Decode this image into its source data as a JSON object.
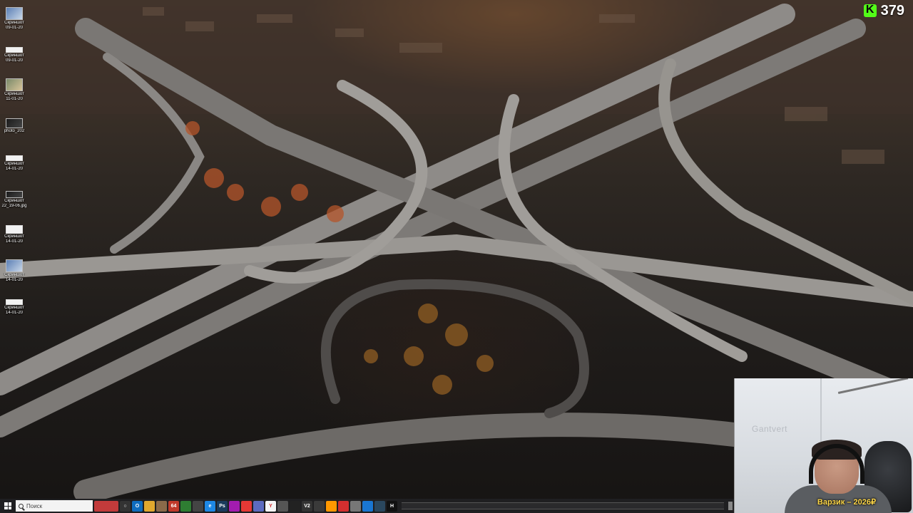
{
  "desktop_icons": [
    {
      "label1": "Скриншот",
      "label2": "09-01-20",
      "thumb": "screenshot"
    },
    {
      "label1": "Скриншот",
      "label2": "09-01-20",
      "thumb": "doc"
    },
    {
      "label1": "Скриншот",
      "label2": "11-01-20",
      "thumb": "photo"
    },
    {
      "label1": "photo_202",
      "label2": "",
      "thumb": "dark"
    },
    {
      "label1": "Скриншот",
      "label2": "14-01-20",
      "thumb": "doc"
    },
    {
      "label1": "Скриншот",
      "label2": "22_19-06.jpg",
      "thumb": "dark"
    },
    {
      "label1": "Скриншот",
      "label2": "14-01-20",
      "thumb": "doc"
    },
    {
      "label1": "Скриншот",
      "label2": "14-01-20",
      "thumb": "screenshot"
    },
    {
      "label1": "Скриншот",
      "label2": "14-01-20",
      "thumb": "doc"
    }
  ],
  "counter": {
    "icon": "kick-logo-icon",
    "value": "379",
    "color": "#53fc18"
  },
  "webcam": {
    "wall_text": "Gantvert",
    "caption": "Варзик – 2026₽"
  },
  "taskbar": {
    "search_placeholder": "Поиск",
    "apps": [
      {
        "name": "widget-app",
        "label": "",
        "color": "#c23b3b",
        "wide": true
      },
      {
        "name": "cortana-app",
        "label": "○",
        "color": "#333"
      },
      {
        "name": "outlook-app",
        "label": "O",
        "color": "#0f6cbd"
      },
      {
        "name": "folder-app",
        "label": "",
        "color": "#e0a82e"
      },
      {
        "name": "tool-app",
        "label": "",
        "color": "#8a6a4a"
      },
      {
        "name": "app-64",
        "label": "64",
        "color": "#c0392b"
      },
      {
        "name": "terminal-app",
        "label": "",
        "color": "#2e7d32"
      },
      {
        "name": "game-app",
        "label": "",
        "color": "#444"
      },
      {
        "name": "edge-app",
        "label": "e",
        "color": "#1e88e5"
      },
      {
        "name": "photoshop-app",
        "label": "Ps",
        "color": "#1a3b5c"
      },
      {
        "name": "media-app",
        "label": "",
        "color": "#a21caf"
      },
      {
        "name": "chrome-app",
        "label": "",
        "color": "#e53935"
      },
      {
        "name": "docs-app",
        "label": "",
        "color": "#5c6bc0"
      },
      {
        "name": "yandex-app",
        "label": "Y",
        "color": "#f5f5f5"
      },
      {
        "name": "settings-app",
        "label": "",
        "color": "#555"
      },
      {
        "name": "xbox-app",
        "label": "",
        "color": "#222"
      },
      {
        "name": "v-app",
        "label": "V2",
        "color": "#333"
      },
      {
        "name": "obs-app",
        "label": "",
        "color": "#3a3a3a"
      },
      {
        "name": "orange-app",
        "label": "",
        "color": "#ff9800"
      },
      {
        "name": "record-app",
        "label": "",
        "color": "#d32f2f"
      },
      {
        "name": "ball-app",
        "label": "",
        "color": "#777"
      },
      {
        "name": "blue-app",
        "label": "",
        "color": "#1976d2"
      },
      {
        "name": "steam-app",
        "label": "",
        "color": "#2a475e"
      },
      {
        "name": "h-app",
        "label": "H",
        "color": "#111"
      }
    ]
  }
}
